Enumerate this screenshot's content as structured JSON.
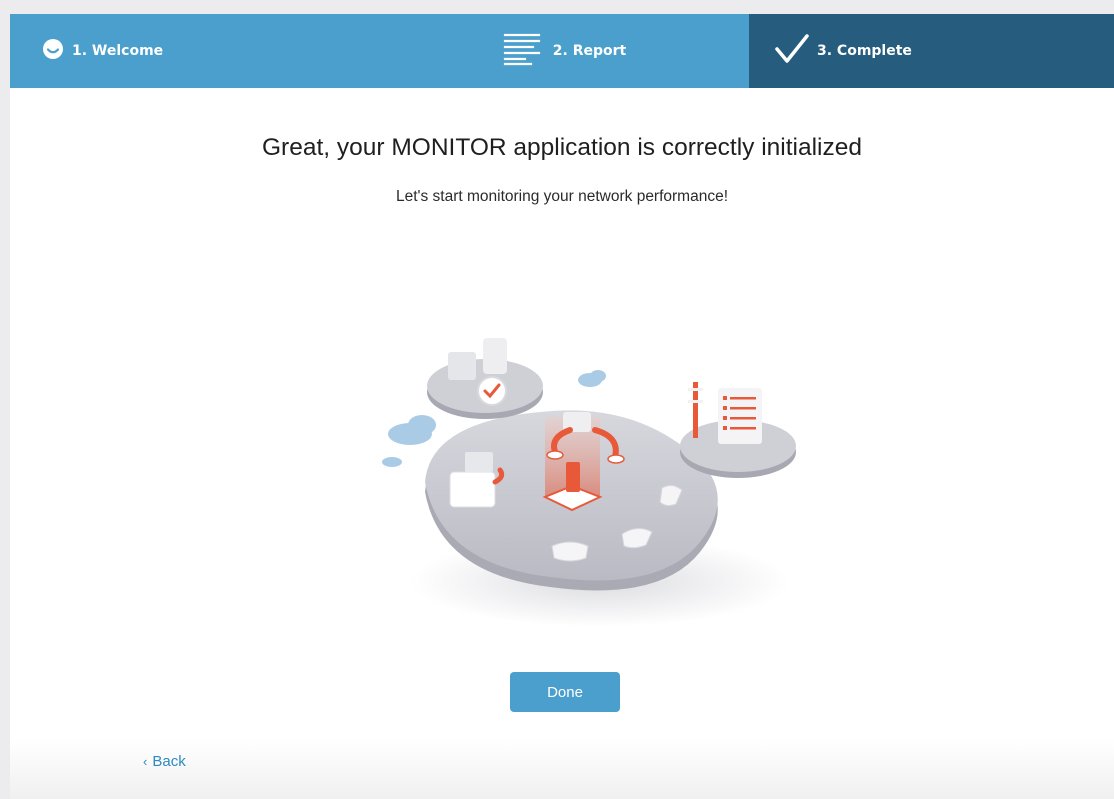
{
  "steps": [
    {
      "label": "1. Welcome",
      "icon": "smile-icon",
      "state": "done"
    },
    {
      "label": "2. Report",
      "icon": "report-lines-icon",
      "state": "done"
    },
    {
      "label": "3. Complete",
      "icon": "checkmark-icon",
      "state": "active"
    }
  ],
  "main": {
    "title": "Great, your MONITOR application is correctly initialized",
    "subtitle": "Let's start monitoring your network performance!",
    "illustration": "network-platform-illustration"
  },
  "actions": {
    "done_label": "Done",
    "back_label": "Back",
    "back_icon": "chevron-left-icon"
  },
  "colors": {
    "step_inactive": "#4a9fcc",
    "step_active": "#265d7e",
    "button": "#4a9fcc",
    "link": "#2d8bc2",
    "accent": "#e8593a"
  }
}
